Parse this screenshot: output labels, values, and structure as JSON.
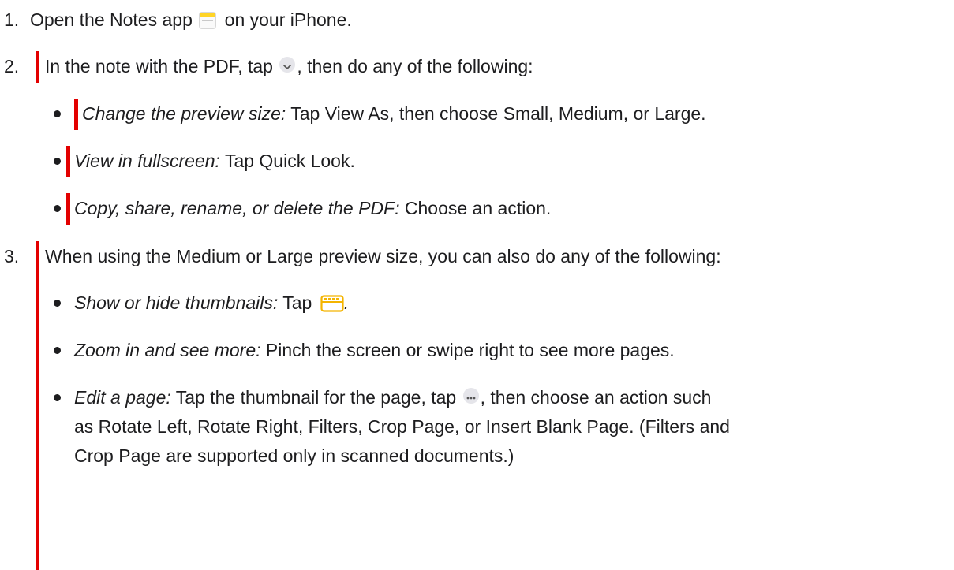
{
  "steps": [
    {
      "number": "1.",
      "text_before": "Open the Notes app",
      "text_after": "on your iPhone.",
      "icon": "notes-app-icon"
    },
    {
      "number": "2.",
      "text_before": "In the note with the PDF, tap",
      "text_after": ", then do any of the following:",
      "icon": "chevron-down-circle-icon",
      "bullets": [
        {
          "label": "Change the preview size:",
          "text": "Tap View As, then choose Small, Medium, or Large."
        },
        {
          "label": "View in fullscreen:",
          "text": "Tap Quick Look."
        },
        {
          "label": "Copy, share, rename, or delete the PDF:",
          "text": "Choose an action."
        }
      ]
    },
    {
      "number": "3.",
      "text": "When using the Medium or Large preview size, you can also do any of the following:",
      "bullets": [
        {
          "label": "Show or hide thumbnails:",
          "text": "Tap",
          "text_after": ".",
          "icon": "thumbnails-icon"
        },
        {
          "label": "Zoom in and see more:",
          "text": "Pinch the screen or swipe right to see more pages."
        },
        {
          "label": "Edit a page:",
          "text": "Tap the thumbnail for the page, tap",
          "icon": "more-circle-icon",
          "text_after": ", then choose an action such",
          "line2": "as Rotate Left, Rotate Right, Filters, Crop Page, or Insert Blank Page. (Filters and",
          "line3": "Crop Page are supported only in scanned documents.)"
        }
      ]
    }
  ],
  "colors": {
    "text": "#1d1d1f",
    "change_bar": "#e30000",
    "notes_yellow": "#ffd426"
  }
}
